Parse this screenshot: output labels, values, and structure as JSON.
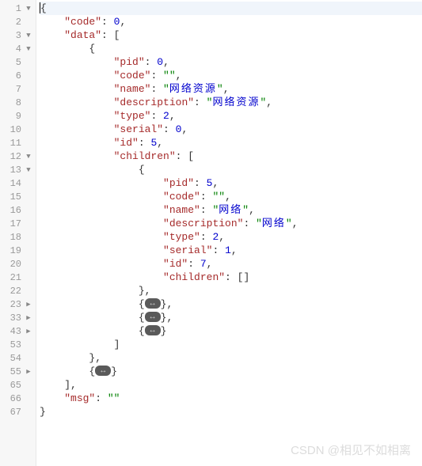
{
  "watermark": "CSDN @相见不如相离",
  "lines": [
    {
      "num": "1",
      "fold": "open",
      "indent": 0,
      "tokens": [
        {
          "t": "punc",
          "v": "{"
        }
      ],
      "cursor": true,
      "hl": true
    },
    {
      "num": "2",
      "fold": "",
      "indent": 1,
      "tokens": [
        {
          "t": "key",
          "v": "\"code\""
        },
        {
          "t": "punc",
          "v": ": "
        },
        {
          "t": "num",
          "v": "0"
        },
        {
          "t": "punc",
          "v": ","
        }
      ]
    },
    {
      "num": "3",
      "fold": "open",
      "indent": 1,
      "tokens": [
        {
          "t": "key",
          "v": "\"data\""
        },
        {
          "t": "punc",
          "v": ": ["
        }
      ]
    },
    {
      "num": "4",
      "fold": "open",
      "indent": 2,
      "tokens": [
        {
          "t": "punc",
          "v": "{"
        }
      ]
    },
    {
      "num": "5",
      "fold": "",
      "indent": 3,
      "tokens": [
        {
          "t": "key",
          "v": "\"pid\""
        },
        {
          "t": "punc",
          "v": ": "
        },
        {
          "t": "num",
          "v": "0"
        },
        {
          "t": "punc",
          "v": ","
        }
      ]
    },
    {
      "num": "6",
      "fold": "",
      "indent": 3,
      "tokens": [
        {
          "t": "key",
          "v": "\"code\""
        },
        {
          "t": "punc",
          "v": ": "
        },
        {
          "t": "str",
          "v": "\"\""
        },
        {
          "t": "punc",
          "v": ","
        }
      ]
    },
    {
      "num": "7",
      "fold": "",
      "indent": 3,
      "tokens": [
        {
          "t": "key",
          "v": "\"name\""
        },
        {
          "t": "punc",
          "v": ": "
        },
        {
          "t": "str",
          "v": "\""
        },
        {
          "t": "str-cn",
          "v": "网络资源"
        },
        {
          "t": "str",
          "v": "\""
        },
        {
          "t": "punc",
          "v": ","
        }
      ]
    },
    {
      "num": "8",
      "fold": "",
      "indent": 3,
      "tokens": [
        {
          "t": "key",
          "v": "\"description\""
        },
        {
          "t": "punc",
          "v": ": "
        },
        {
          "t": "str",
          "v": "\""
        },
        {
          "t": "str-cn",
          "v": "网络资源"
        },
        {
          "t": "str",
          "v": "\""
        },
        {
          "t": "punc",
          "v": ","
        }
      ]
    },
    {
      "num": "9",
      "fold": "",
      "indent": 3,
      "tokens": [
        {
          "t": "key",
          "v": "\"type\""
        },
        {
          "t": "punc",
          "v": ": "
        },
        {
          "t": "num",
          "v": "2"
        },
        {
          "t": "punc",
          "v": ","
        }
      ]
    },
    {
      "num": "10",
      "fold": "",
      "indent": 3,
      "tokens": [
        {
          "t": "key",
          "v": "\"serial\""
        },
        {
          "t": "punc",
          "v": ": "
        },
        {
          "t": "num",
          "v": "0"
        },
        {
          "t": "punc",
          "v": ","
        }
      ]
    },
    {
      "num": "11",
      "fold": "",
      "indent": 3,
      "tokens": [
        {
          "t": "key",
          "v": "\"id\""
        },
        {
          "t": "punc",
          "v": ": "
        },
        {
          "t": "num",
          "v": "5"
        },
        {
          "t": "punc",
          "v": ","
        }
      ]
    },
    {
      "num": "12",
      "fold": "open",
      "indent": 3,
      "tokens": [
        {
          "t": "key",
          "v": "\"children\""
        },
        {
          "t": "punc",
          "v": ": ["
        }
      ]
    },
    {
      "num": "13",
      "fold": "open",
      "indent": 4,
      "tokens": [
        {
          "t": "punc",
          "v": "{"
        }
      ]
    },
    {
      "num": "14",
      "fold": "",
      "indent": 5,
      "tokens": [
        {
          "t": "key",
          "v": "\"pid\""
        },
        {
          "t": "punc",
          "v": ": "
        },
        {
          "t": "num",
          "v": "5"
        },
        {
          "t": "punc",
          "v": ","
        }
      ]
    },
    {
      "num": "15",
      "fold": "",
      "indent": 5,
      "tokens": [
        {
          "t": "key",
          "v": "\"code\""
        },
        {
          "t": "punc",
          "v": ": "
        },
        {
          "t": "str",
          "v": "\"\""
        },
        {
          "t": "punc",
          "v": ","
        }
      ]
    },
    {
      "num": "16",
      "fold": "",
      "indent": 5,
      "tokens": [
        {
          "t": "key",
          "v": "\"name\""
        },
        {
          "t": "punc",
          "v": ": "
        },
        {
          "t": "str",
          "v": "\""
        },
        {
          "t": "str-cn",
          "v": "网络"
        },
        {
          "t": "str",
          "v": "\""
        },
        {
          "t": "punc",
          "v": ","
        }
      ]
    },
    {
      "num": "17",
      "fold": "",
      "indent": 5,
      "tokens": [
        {
          "t": "key",
          "v": "\"description\""
        },
        {
          "t": "punc",
          "v": ": "
        },
        {
          "t": "str",
          "v": "\""
        },
        {
          "t": "str-cn",
          "v": "网络"
        },
        {
          "t": "str",
          "v": "\""
        },
        {
          "t": "punc",
          "v": ","
        }
      ]
    },
    {
      "num": "18",
      "fold": "",
      "indent": 5,
      "tokens": [
        {
          "t": "key",
          "v": "\"type\""
        },
        {
          "t": "punc",
          "v": ": "
        },
        {
          "t": "num",
          "v": "2"
        },
        {
          "t": "punc",
          "v": ","
        }
      ]
    },
    {
      "num": "19",
      "fold": "",
      "indent": 5,
      "tokens": [
        {
          "t": "key",
          "v": "\"serial\""
        },
        {
          "t": "punc",
          "v": ": "
        },
        {
          "t": "num",
          "v": "1"
        },
        {
          "t": "punc",
          "v": ","
        }
      ]
    },
    {
      "num": "20",
      "fold": "",
      "indent": 5,
      "tokens": [
        {
          "t": "key",
          "v": "\"id\""
        },
        {
          "t": "punc",
          "v": ": "
        },
        {
          "t": "num",
          "v": "7"
        },
        {
          "t": "punc",
          "v": ","
        }
      ]
    },
    {
      "num": "21",
      "fold": "",
      "indent": 5,
      "tokens": [
        {
          "t": "key",
          "v": "\"children\""
        },
        {
          "t": "punc",
          "v": ": []"
        }
      ]
    },
    {
      "num": "22",
      "fold": "",
      "indent": 4,
      "tokens": [
        {
          "t": "punc",
          "v": "},"
        }
      ]
    },
    {
      "num": "23",
      "fold": "closed",
      "indent": 4,
      "tokens": [
        {
          "t": "punc",
          "v": "{"
        },
        {
          "t": "pill",
          "v": ""
        },
        {
          "t": "punc",
          "v": "},"
        }
      ]
    },
    {
      "num": "33",
      "fold": "closed",
      "indent": 4,
      "tokens": [
        {
          "t": "punc",
          "v": "{"
        },
        {
          "t": "pill",
          "v": ""
        },
        {
          "t": "punc",
          "v": "},"
        }
      ]
    },
    {
      "num": "43",
      "fold": "closed",
      "indent": 4,
      "tokens": [
        {
          "t": "punc",
          "v": "{"
        },
        {
          "t": "pill",
          "v": ""
        },
        {
          "t": "punc",
          "v": "}"
        }
      ]
    },
    {
      "num": "53",
      "fold": "",
      "indent": 3,
      "tokens": [
        {
          "t": "punc",
          "v": "]"
        }
      ]
    },
    {
      "num": "54",
      "fold": "",
      "indent": 2,
      "tokens": [
        {
          "t": "punc",
          "v": "},"
        }
      ]
    },
    {
      "num": "55",
      "fold": "closed",
      "indent": 2,
      "tokens": [
        {
          "t": "punc",
          "v": "{"
        },
        {
          "t": "pill",
          "v": ""
        },
        {
          "t": "punc",
          "v": "}"
        }
      ]
    },
    {
      "num": "65",
      "fold": "",
      "indent": 1,
      "tokens": [
        {
          "t": "punc",
          "v": "],"
        }
      ]
    },
    {
      "num": "66",
      "fold": "",
      "indent": 1,
      "tokens": [
        {
          "t": "key",
          "v": "\"msg\""
        },
        {
          "t": "punc",
          "v": ": "
        },
        {
          "t": "str",
          "v": "\"\""
        }
      ]
    },
    {
      "num": "67",
      "fold": "",
      "indent": 0,
      "tokens": [
        {
          "t": "punc",
          "v": "}"
        }
      ]
    }
  ]
}
